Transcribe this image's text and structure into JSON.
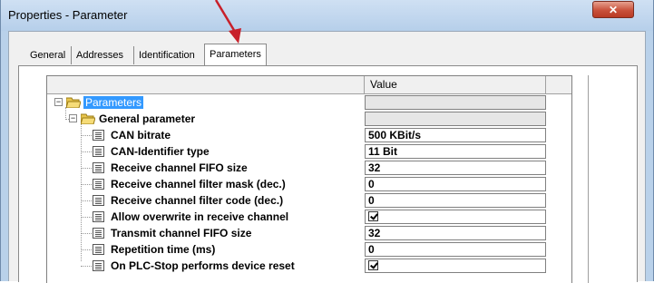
{
  "window": {
    "title": "Properties - Parameter",
    "close_symbol": "✕"
  },
  "tabs": [
    {
      "label": "General",
      "active": false
    },
    {
      "label": "Addresses",
      "active": false
    },
    {
      "label": "Identification",
      "active": false
    },
    {
      "label": "Parameters",
      "active": true
    }
  ],
  "grid": {
    "value_header": "Value",
    "root": {
      "label": "Parameters",
      "expanded": true,
      "selected": true
    },
    "group": {
      "label": "General parameter",
      "expanded": true
    },
    "rows": [
      {
        "label": "CAN bitrate",
        "value": "500 KBit/s",
        "type": "text"
      },
      {
        "label": "CAN-Identifier type",
        "value": "11 Bit",
        "type": "text"
      },
      {
        "label": "Receive channel FIFO size",
        "value": "32",
        "type": "text"
      },
      {
        "label": "Receive channel filter mask (dec.)",
        "value": "0",
        "type": "text"
      },
      {
        "label": "Receive channel filter code (dec.)",
        "value": "0",
        "type": "text"
      },
      {
        "label": "Allow overwrite in receive channel",
        "value": "checked",
        "type": "checkbox"
      },
      {
        "label": "Transmit channel FIFO size",
        "value": "32",
        "type": "text"
      },
      {
        "label": "Repetition time (ms)",
        "value": "0",
        "type": "text"
      },
      {
        "label": "On PLC-Stop performs device reset",
        "value": "checked",
        "type": "checkbox"
      }
    ]
  },
  "colors": {
    "selection": "#3399ff",
    "arrow": "#c8202a",
    "close_button": "#c9513b"
  }
}
